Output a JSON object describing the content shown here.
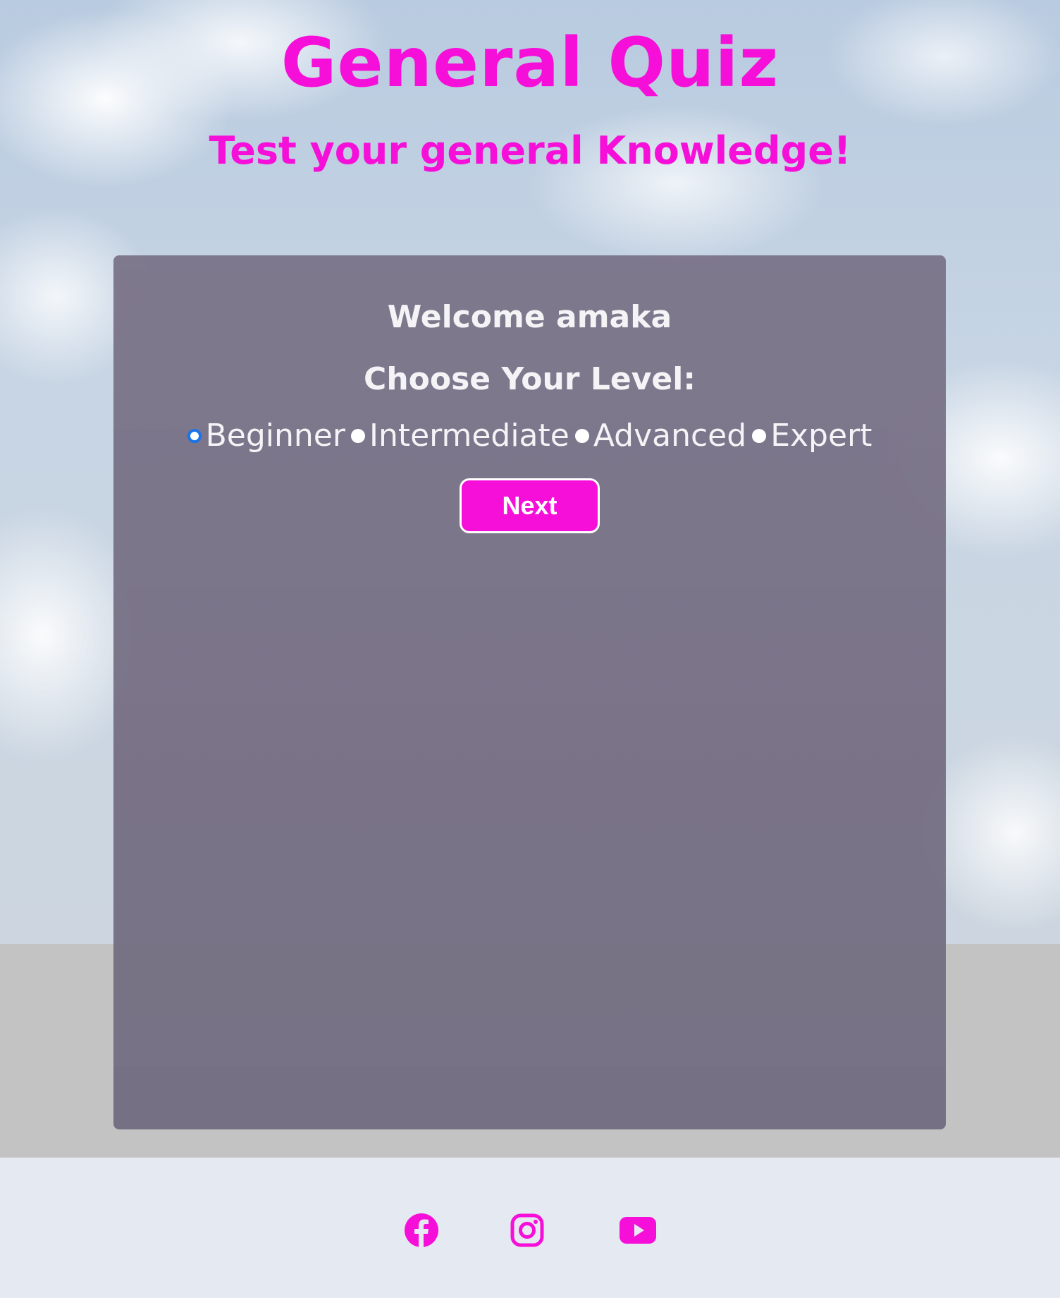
{
  "header": {
    "title": "General Quiz",
    "subtitle": "Test your general Knowledge!"
  },
  "panel": {
    "welcome": "Welcome amaka",
    "choose_level": "Choose Your Level:",
    "levels": [
      {
        "label": "Beginner",
        "selected": true
      },
      {
        "label": "Intermediate",
        "selected": false
      },
      {
        "label": "Advanced",
        "selected": false
      },
      {
        "label": "Expert",
        "selected": false
      }
    ],
    "next_label": "Next"
  },
  "footer": {
    "icons": [
      "facebook-icon",
      "instagram-icon",
      "youtube-icon"
    ]
  },
  "colors": {
    "accent": "#f50fd8",
    "radio_selected": "#1a73e8",
    "footer_bg": "#e5e9f1"
  }
}
